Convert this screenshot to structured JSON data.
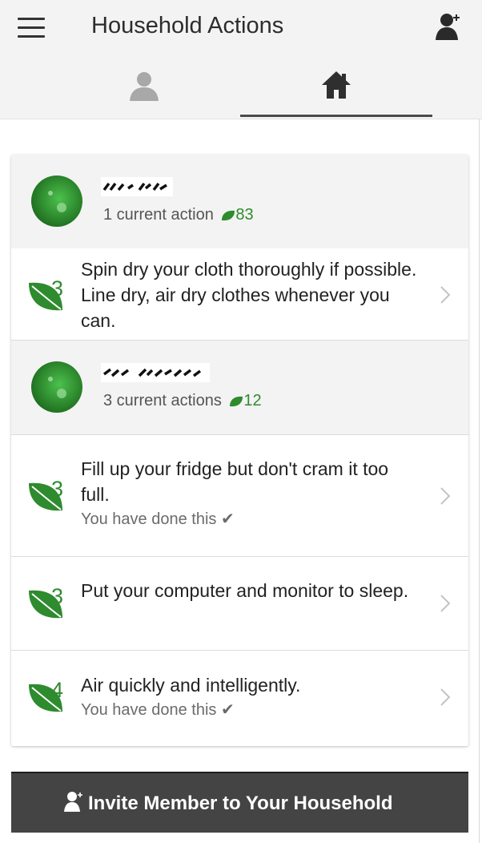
{
  "header": {
    "title": "Household Actions",
    "menu_icon": "hamburger-icon",
    "invite_icon": "add-user-icon"
  },
  "tabs": [
    {
      "name": "personal",
      "icon": "user-icon",
      "active": false
    },
    {
      "name": "household",
      "icon": "home-icon",
      "active": true
    }
  ],
  "colors": {
    "leaf_green": "#2e8b2e",
    "bar_bg": "#f3f3f3",
    "button_bg": "#444444"
  },
  "members": [
    {
      "actions_summary": "1 current action",
      "points": "83",
      "actions": [
        {
          "points": "3",
          "text": "Spin dry your cloth thoroughly if possible. Line dry, air dry clothes whenever you can.",
          "done_text": ""
        }
      ]
    },
    {
      "actions_summary": "3 current actions",
      "points": "12",
      "actions": [
        {
          "points": "3",
          "text": "Fill up your fridge but don't cram it too full.",
          "done_text": "You have done this ✔"
        },
        {
          "points": "3",
          "text": "Put your computer and monitor to sleep.",
          "done_text": ""
        },
        {
          "points": "4",
          "text": "Air quickly and intelligently.",
          "done_text": "You have done this ✔"
        }
      ]
    }
  ],
  "invite_button": {
    "label": "Invite Member to Your Household"
  }
}
